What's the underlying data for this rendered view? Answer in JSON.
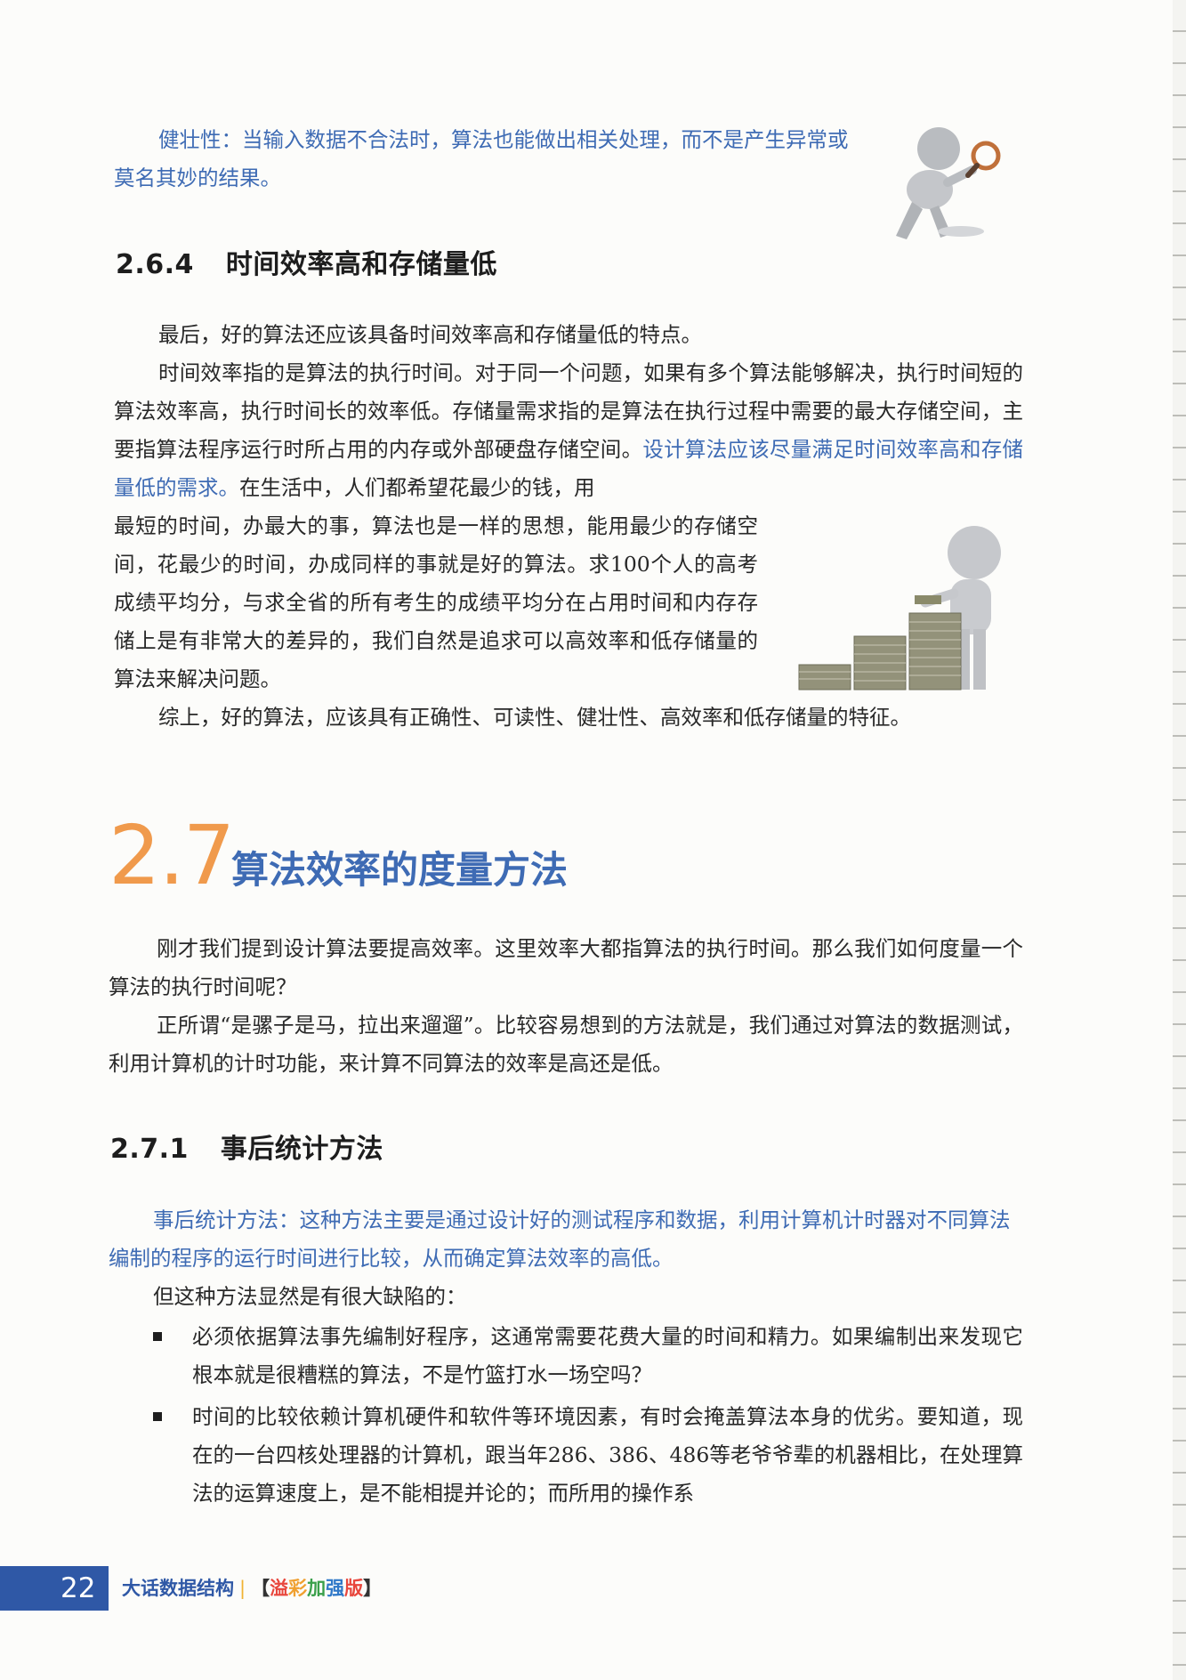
{
  "intro_note": {
    "term": "健壮性：",
    "text": "当输入数据不合法时，算法也能做出相关处理，而不是产生异常或莫名其妙的结果。"
  },
  "section_264": {
    "number": "2.6.4",
    "title": "时间效率高和存储量低",
    "p1": "最后，好的算法还应该具备时间效率高和存储量低的特点。",
    "p2_a": "时间效率指的是算法的执行时间。对于同一个问题，如果有多个算法能够解决，执行时间短的算法效率高，执行时间长的效率低。存储量需求指的是算法在执行过程中需要的最大存储空间，主要指算法程序运行时所占用的内存或外部硬盘存储空间。",
    "p2_highlight": "设计算法应该尽量满足时间效率高和存储量低的需求。",
    "p2_b": "在生活中，人们都希望花最少的钱，用",
    "p2_c": "最短的时间，办最大的事，算法也是一样的思想，能用最少的存储空间，花最少的时间，办成同样的事就是好的算法。求100个人的高考成绩平均分，与求全省的所有考生的成绩平均分在占用时间和内存存储上是有非常大的差异的，我们自然是追求可以高效率和低存储量的算法来解决问题。",
    "p3": "综上，好的算法，应该具有正确性、可读性、健壮性、高效率和低存储量的特征。"
  },
  "chapter_27": {
    "number": "2.7",
    "title": "算法效率的度量方法",
    "p1": "刚才我们提到设计算法要提高效率。这里效率大都指算法的执行时间。那么我们如何度量一个算法的执行时间呢？",
    "p2": "正所谓“是骡子是马，拉出来遛遛”。比较容易想到的方法就是，我们通过对算法的数据测试，利用计算机的计时功能，来计算不同算法的效率是高还是低。"
  },
  "section_271": {
    "number": "2.7.1",
    "title": "事后统计方法",
    "note_term": "事后统计方法：",
    "note_text": "这种方法主要是通过设计好的测试程序和数据，利用计算机计时器对不同算法编制的程序的运行时间进行比较，从而确定算法效率的高低。",
    "p1": "但这种方法显然是有很大缺陷的：",
    "bullets": [
      "必须依据算法事先编制好程序，这通常需要花费大量的时间和精力。如果编制出来发现它根本就是很糟糕的算法，不是竹篮打水一场空吗？",
      "时间的比较依赖计算机硬件和软件等环境因素，有时会掩盖算法本身的优劣。要知道，现在的一台四核处理器的计算机，跟当年286、386、486等老爷爷辈的机器相比，在处理算法的运算速度上，是不能相提并论的；而所用的操作系"
    ]
  },
  "footer": {
    "page_number": "22",
    "book_title": "大话数据结构",
    "separator": "|",
    "bracket_open": "【",
    "edition_1": "溢",
    "edition_2": "彩",
    "edition_3": "加",
    "edition_4": "强",
    "edition_5": "版",
    "bracket_close": "】"
  },
  "illustrations": [
    {
      "icon": "magnifier-figure-icon"
    },
    {
      "icon": "coin-stacks-figure-icon"
    }
  ],
  "colors": {
    "accent_blue": "#3e6bb4",
    "chapter_orange": "#f09a4c",
    "footer_blue": "#2f58a6"
  }
}
